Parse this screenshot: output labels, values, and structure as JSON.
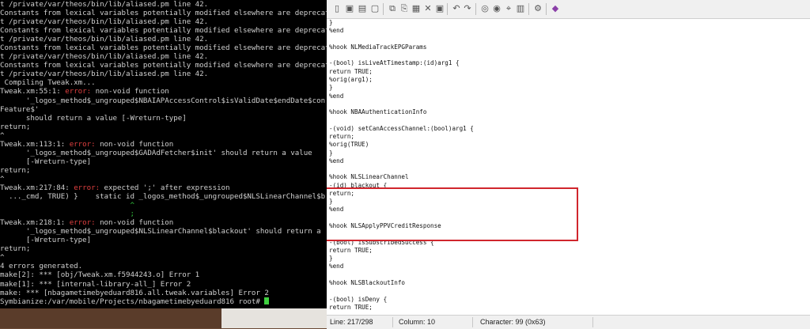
{
  "terminal": {
    "lines": [
      [
        {
          "t": "t /private/var/theos/bin/lib/aliased.pm line 42."
        }
      ],
      [
        {
          "t": "Constants from lexical variables potentially modified elsewhere are deprecat"
        }
      ],
      [
        {
          "t": "t /private/var/theos/bin/lib/aliased.pm line 42."
        }
      ],
      [
        {
          "t": "Constants from lexical variables potentially modified elsewhere are deprecat"
        }
      ],
      [
        {
          "t": "t /private/var/theos/bin/lib/aliased.pm line 42."
        }
      ],
      [
        {
          "t": "Constants from lexical variables potentially modified elsewhere are deprecat"
        }
      ],
      [
        {
          "t": "t /private/var/theos/bin/lib/aliased.pm line 42."
        }
      ],
      [
        {
          "t": "Constants from lexical variables potentially modified elsewhere are deprecat"
        }
      ],
      [
        {
          "t": "t /private/var/theos/bin/lib/aliased.pm line 42."
        }
      ],
      [
        {
          "t": " Compiling Tweak.xm..."
        }
      ],
      [
        {
          "t": "Tweak.xm:55:1: "
        },
        {
          "t": "error:",
          "c": "r"
        },
        {
          "t": " non-void function"
        }
      ],
      [
        {
          "t": "      '_logos_method$_ungrouped$NBAIAPAccessControl$isValidDate$endDate$con"
        }
      ],
      [
        {
          "t": "Feature$'"
        }
      ],
      [
        {
          "t": "      should return a value [-Wreturn-type]"
        }
      ],
      [
        {
          "t": "return;"
        }
      ],
      [
        {
          "t": "^"
        }
      ],
      [
        {
          "t": "Tweak.xm:113:1: "
        },
        {
          "t": "error:",
          "c": "r"
        },
        {
          "t": " non-void function"
        }
      ],
      [
        {
          "t": "      '_logos_method$_ungrouped$GADAdFetcher$init' should return a value"
        }
      ],
      [
        {
          "t": "      [-Wreturn-type]"
        }
      ],
      [
        {
          "t": "return;"
        }
      ],
      [
        {
          "t": "^"
        }
      ],
      [
        {
          "t": "Tweak.xm:217:84: "
        },
        {
          "t": "error:",
          "c": "r"
        },
        {
          "t": " expected ';' after expression"
        }
      ],
      [
        {
          "t": "  ..._cmd, TRUE) }    static id _logos_method$_ungrouped$NLSLinearChannel$b"
        }
      ],
      [
        {
          "t": "                              ",
          "c": ""
        },
        {
          "t": "^",
          "c": "g"
        }
      ],
      [
        {
          "t": "                              ",
          "c": ""
        },
        {
          "t": ";",
          "c": "g"
        }
      ],
      [
        {
          "t": "Tweak.xm:218:1: "
        },
        {
          "t": "error:",
          "c": "r"
        },
        {
          "t": " non-void function"
        }
      ],
      [
        {
          "t": "      '_logos_method$_ungrouped$NLSLinearChannel$blackout' should return a"
        }
      ],
      [
        {
          "t": "      [-Wreturn-type]"
        }
      ],
      [
        {
          "t": "return;"
        }
      ],
      [
        {
          "t": "^"
        }
      ],
      [
        {
          "t": "4 errors generated."
        }
      ],
      [
        {
          "t": "make[2]: *** [obj/Tweak.xm.f5944243.o] Error 1"
        }
      ],
      [
        {
          "t": "make[1]: *** [internal-library-all_] Error 2"
        }
      ],
      [
        {
          "t": "make: *** [nbagametimebyeduard816.all.tweak.variables] Error 2"
        }
      ],
      [
        {
          "t": "Symbianize:/var/mobile/Projects/nbagametimebyeduard816 root# "
        }
      ]
    ]
  },
  "editor": {
    "toolbar_icons": [
      "new-file-icon",
      "save-icon",
      "save-all-icon",
      "close-icon",
      "cut-icon",
      "copy-icon",
      "paste-icon",
      "delete-icon",
      "select-all-icon",
      "undo-icon",
      "redo-icon",
      "find-icon",
      "find-prev-icon",
      "replace-icon",
      "goto-icon",
      "settings-icon",
      "help-book-icon"
    ],
    "code_lines": [
      "}",
      "%end",
      "",
      "%hook NLMediaTrackEPGParams",
      "",
      "-(bool) isLiveAtTimestamp:(id)arg1 {",
      "return TRUE;",
      "%orig(arg1);",
      "}",
      "%end",
      "",
      "%hook NBAAuthenticationInfo",
      "",
      "-(void) setCanAccessChannel:(bool)arg1 {",
      "return;",
      "%orig(TRUE)",
      "}",
      "%end",
      "",
      "%hook NLSLinearChannel",
      "-(id) blackout {",
      "return;",
      "}",
      "%end",
      "",
      "%hook NLSApplyPPVCreditResponse",
      "",
      "-(bool) isSubscribedSuccess {",
      "return TRUE;",
      "}",
      "%end",
      "",
      "%hook NLSBlackoutInfo",
      "",
      "-(bool) isDeny {",
      "return TRUE;"
    ],
    "status": {
      "line": "Line: 217/298",
      "column": "Column: 10",
      "character": "Character: 99 (0x63)"
    }
  },
  "colors": {
    "highlight_box": "#d0262d",
    "error": "#e04040",
    "caret": "#2fbf3a"
  }
}
